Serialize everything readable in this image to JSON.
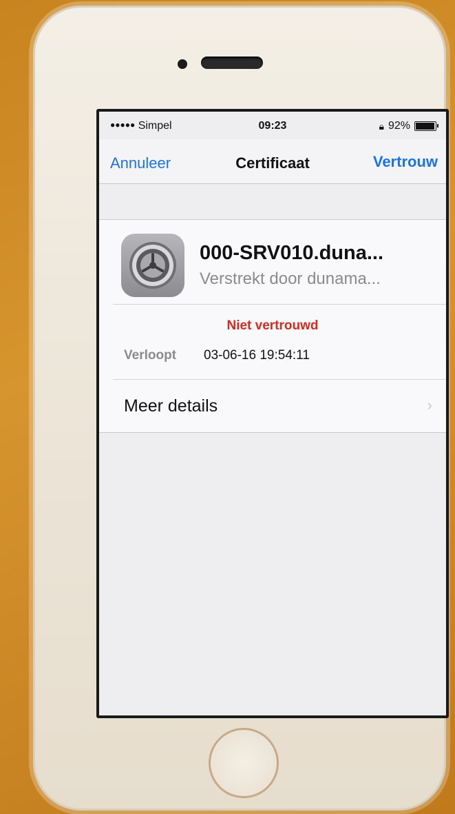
{
  "status_bar": {
    "signal_dots": "●●●●●",
    "carrier": "Simpel",
    "time": "09:23",
    "battery_percent": "92%",
    "battery_level": 0.92
  },
  "nav": {
    "cancel_label": "Annuleer",
    "title": "Certificaat",
    "trust_label": "Vertrouw"
  },
  "certificate": {
    "icon": "gear-icon",
    "name": "000-SRV010.duna...",
    "issuer": "Verstrekt door dunama...",
    "status": "Niet vertrouwd",
    "expires_label": "Verloopt",
    "expires_value": "03-06-16 19:54:11",
    "more_details_label": "Meer details"
  },
  "colors": {
    "accent": "#1a73e8",
    "warning": "#d42a1f"
  }
}
